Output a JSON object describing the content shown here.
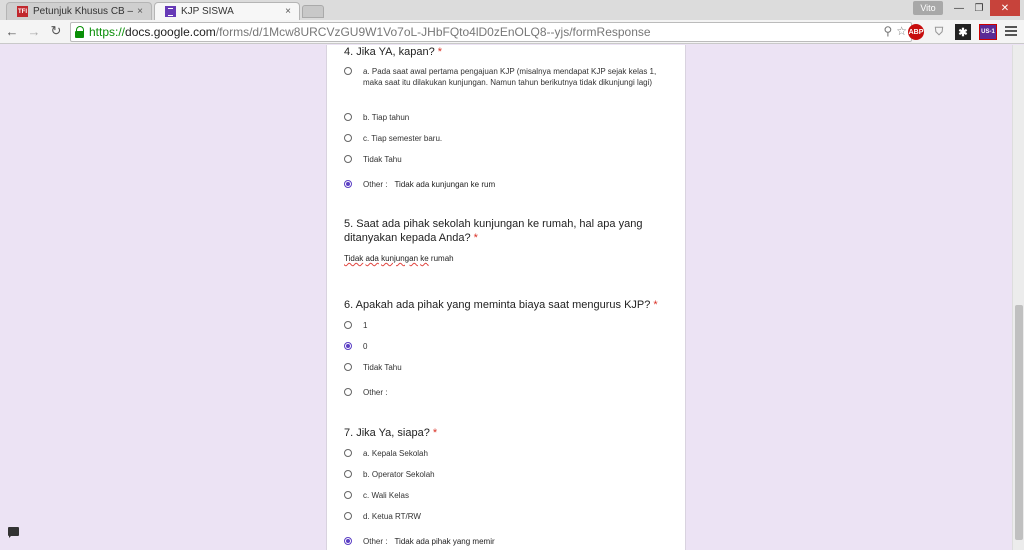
{
  "browser": {
    "tabs": [
      {
        "label": "Petunjuk Khusus CB – Pro"
      },
      {
        "label": "KJP SISWA"
      }
    ],
    "tab_close": "×",
    "tfi_favicon": "TFI",
    "user": "Vito",
    "window": {
      "minimize": "—",
      "maximize": "❐",
      "close": "✕"
    },
    "nav": {
      "back": "←",
      "forward": "→",
      "reload": "↻"
    },
    "url": {
      "scheme": "https://",
      "host": "docs.google.com",
      "path": "/forms/d/1Mcw8URCVzGU9W1Vo7oL-JHbFQto4lD0zEnOLQ8--yjs/formResponse"
    },
    "omni_icons": {
      "search": "⚲",
      "bookmark": "☆"
    },
    "extensions": {
      "abp": "ABP",
      "shield": "⛉",
      "star": "✱",
      "us": "US-1"
    }
  },
  "form": {
    "q4": {
      "title": "4. Jika YA, kapan?",
      "required": "*",
      "options": [
        "a. Pada saat awal pertama pengajuan KJP (misalnya mendapat KJP sejak kelas 1, maka saat itu dilakukan kunjungan. Namun tahun berikutnya tidak dikunjungi lagi)",
        "b. Tiap tahun",
        "c. Tiap semester baru.",
        "Tidak Tahu",
        "Other :"
      ],
      "other_value": "Tidak ada kunjungan ke rum"
    },
    "q5": {
      "title": "5. Saat ada pihak sekolah kunjungan ke rumah, hal apa yang ditanyakan kepada Anda?",
      "required": "*",
      "answer_parts": [
        "Tidak",
        " ",
        "ada",
        " ",
        "kunjungan",
        " ",
        "ke",
        " rumah"
      ]
    },
    "q6": {
      "title": "6. Apakah ada pihak yang meminta biaya saat mengurus KJP?",
      "required": "*",
      "options": [
        "1",
        "0",
        "Tidak Tahu",
        "Other :"
      ]
    },
    "q7": {
      "title": "7. Jika Ya, siapa?",
      "required": "*",
      "options": [
        "a. Kepala Sekolah",
        "b. Operator Sekolah",
        "c. Wali Kelas",
        "d. Ketua RT/RW",
        "Other :"
      ],
      "other_value": "Tidak ada pihak yang memir"
    }
  }
}
